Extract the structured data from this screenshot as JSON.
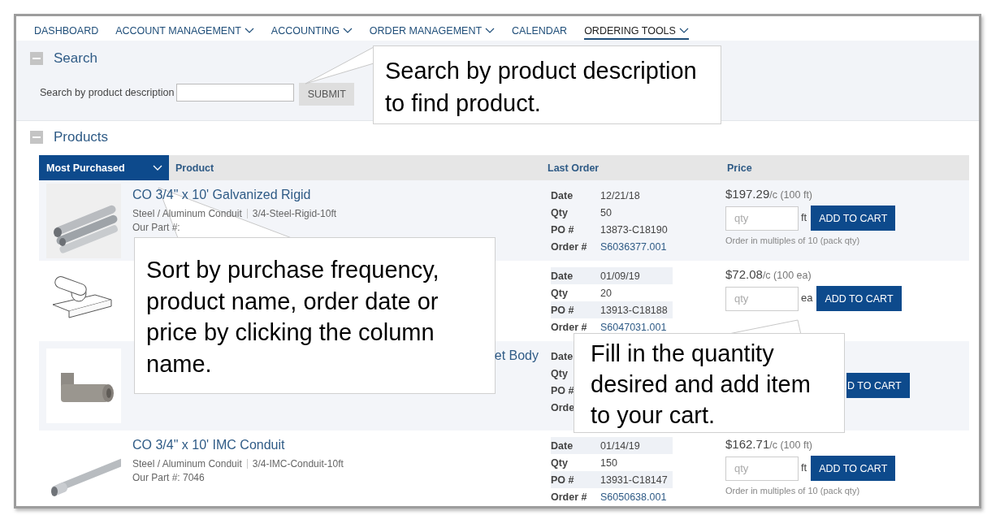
{
  "nav": [
    {
      "label": "DASHBOARD",
      "dropdown": false,
      "selected": false
    },
    {
      "label": "ACCOUNT MANAGEMENT",
      "dropdown": true,
      "selected": false
    },
    {
      "label": "ACCOUNTING",
      "dropdown": true,
      "selected": false
    },
    {
      "label": "ORDER MANAGEMENT",
      "dropdown": true,
      "selected": false
    },
    {
      "label": "CALENDAR",
      "dropdown": false,
      "selected": false
    },
    {
      "label": "ORDERING TOOLS",
      "dropdown": true,
      "selected": true
    }
  ],
  "search": {
    "title": "Search",
    "label": "Search by product description",
    "button": "SUBMIT"
  },
  "products": {
    "title": "Products",
    "columns": [
      {
        "label": "Most Purchased",
        "kind": "sort"
      },
      {
        "label": "Product",
        "kind": "plain"
      },
      {
        "label": "Last Order",
        "kind": "plain"
      },
      {
        "label": "Price",
        "kind": "plain"
      }
    ],
    "rows": [
      {
        "shaded": true,
        "title": "CO 3/4\" x 10' Galvanized Rigid",
        "category": "Steel / Aluminum Conduit",
        "sku": "3/4-Steel-Rigid-10ft",
        "part": "Our Part #:",
        "order": [
          {
            "label": "Date",
            "value": "12/21/18"
          },
          {
            "label": "Qty",
            "value": "50"
          },
          {
            "label": "PO #",
            "value": "13873-C18190"
          },
          {
            "label": "Order #",
            "value": "S6036377.001",
            "link": true
          }
        ],
        "price": {
          "amount": "$197.29",
          "per": "/c",
          "unit": "(100 ft)"
        },
        "qty_placeholder": "qty",
        "uom": "ft",
        "button": "ADD TO CART",
        "note": "Order in multiples of 10 (pack qty)"
      },
      {
        "shaded": false,
        "order": [
          {
            "label": "Date",
            "value": "01/09/19"
          },
          {
            "label": "Qty",
            "value": "20"
          },
          {
            "label": "PO #",
            "value": "13913-C18188"
          },
          {
            "label": "Order #",
            "value": "S6047031.001",
            "link": true
          }
        ],
        "price": {
          "amount": "$72.08",
          "per": "/c",
          "unit": "(100 ea)"
        },
        "qty_placeholder": "qty",
        "uom": "ea",
        "button": "ADD TO CART"
      },
      {
        "shaded": true,
        "title": "et Body",
        "order": [
          {
            "label": "Date"
          },
          {
            "label": "Qty"
          },
          {
            "label": "PO #"
          },
          {
            "label": "Orde"
          }
        ],
        "button": "D TO CART"
      },
      {
        "shaded": false,
        "title": "CO 3/4\" x 10' IMC Conduit",
        "category": "Steel / Aluminum Conduit",
        "sku": "3/4-IMC-Conduit-10ft",
        "part": "Our Part #: 7046",
        "order": [
          {
            "label": "Date",
            "value": "01/14/19"
          },
          {
            "label": "Qty",
            "value": "150"
          },
          {
            "label": "PO #",
            "value": "13931-C18147"
          },
          {
            "label": "Order #",
            "value": "S6050638.001",
            "link": true
          }
        ],
        "price": {
          "amount": "$162.71",
          "per": "/c",
          "unit": "(100 ft)"
        },
        "qty_placeholder": "qty",
        "uom": "ft",
        "button": "ADD TO CART",
        "note": "Order in multiples of 10 (pack qty)"
      }
    ]
  },
  "callouts": [
    "Search by product description to find product.",
    "Sort by purchase frequency, product name, order date or price by clicking the column name.",
    "Fill in the quantity desired and add item to your cart."
  ]
}
